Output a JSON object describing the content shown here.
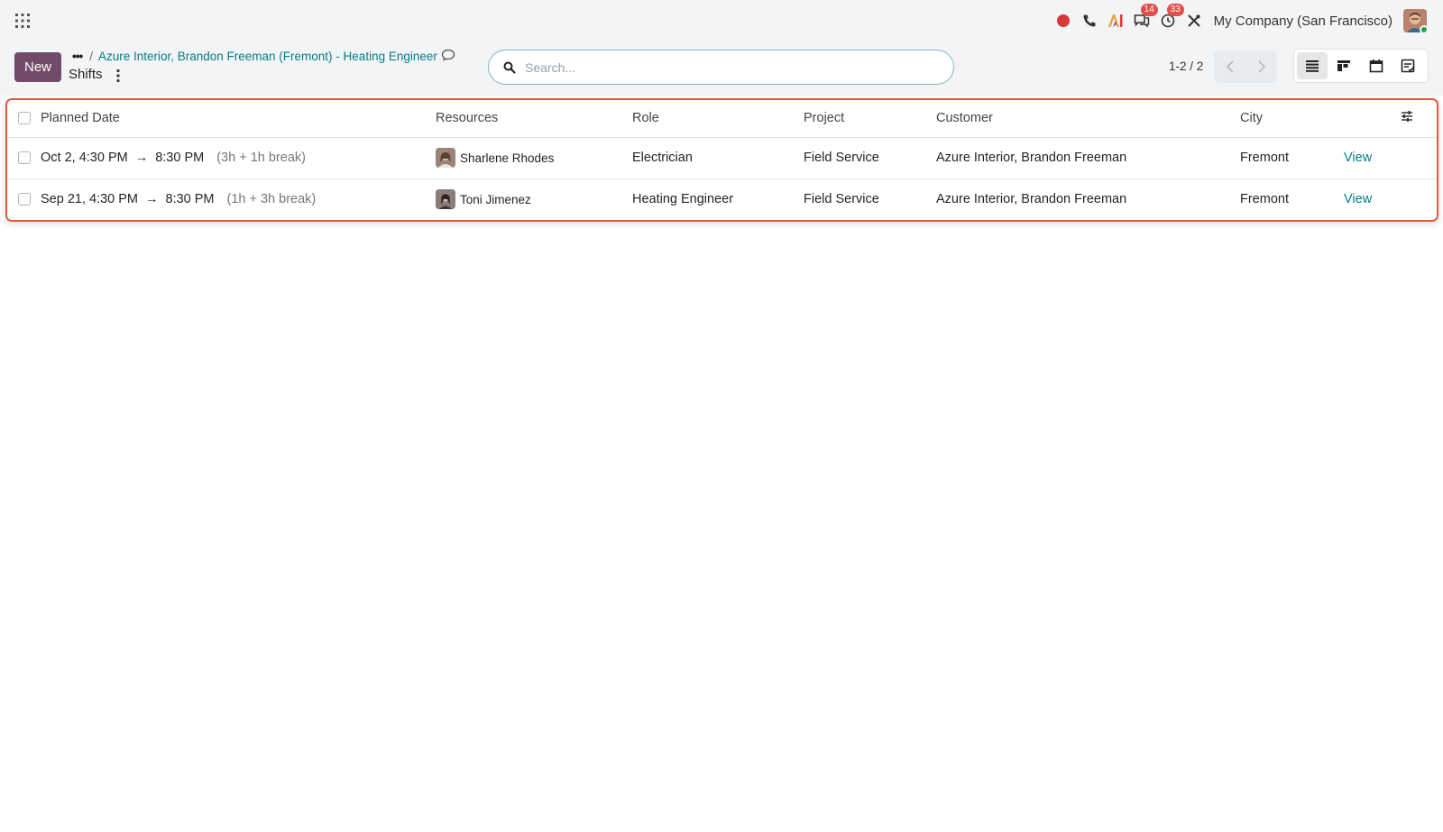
{
  "navbar": {
    "company": "My Company (San Francisco)",
    "messages_count": "14",
    "activities_count": "33",
    "icons": [
      "apps-grid-icon",
      "record-icon",
      "phone-icon",
      "ai-icon",
      "chat-icon",
      "clock-icon",
      "tools-icon"
    ]
  },
  "control": {
    "new_label": "New",
    "breadcrumb_dots": "•••",
    "breadcrumb_sep": "/",
    "breadcrumb_parent": "Azure Interior, Brandon Freeman (Fremont) - Heating Engineer",
    "title": "Shifts",
    "search_placeholder": "Search...",
    "pager": "1-2 / 2"
  },
  "table": {
    "columns": [
      "Planned Date",
      "Resources",
      "Role",
      "Project",
      "Customer",
      "City"
    ],
    "rows": [
      {
        "start": "Oct 2, 4:30 PM",
        "arrow": "→",
        "end": "8:30 PM",
        "break": "(3h + 1h break)",
        "resource": "Sharlene Rhodes",
        "role": "Electrician",
        "project": "Field Service",
        "customer": "Azure Interior, Brandon Freeman",
        "city": "Fremont",
        "action": "View"
      },
      {
        "start": "Sep 21, 4:30 PM",
        "arrow": "→",
        "end": "8:30 PM",
        "break": "(1h + 3h break)",
        "resource": "Toni Jimenez",
        "role": "Heating Engineer",
        "project": "Field Service",
        "customer": "Azure Interior, Brandon Freeman",
        "city": "Fremont",
        "action": "View"
      }
    ]
  },
  "colors": {
    "brand": "#714b67",
    "link": "#017e84",
    "highlight_border": "#e05a3c",
    "badge": "#e2504a"
  }
}
